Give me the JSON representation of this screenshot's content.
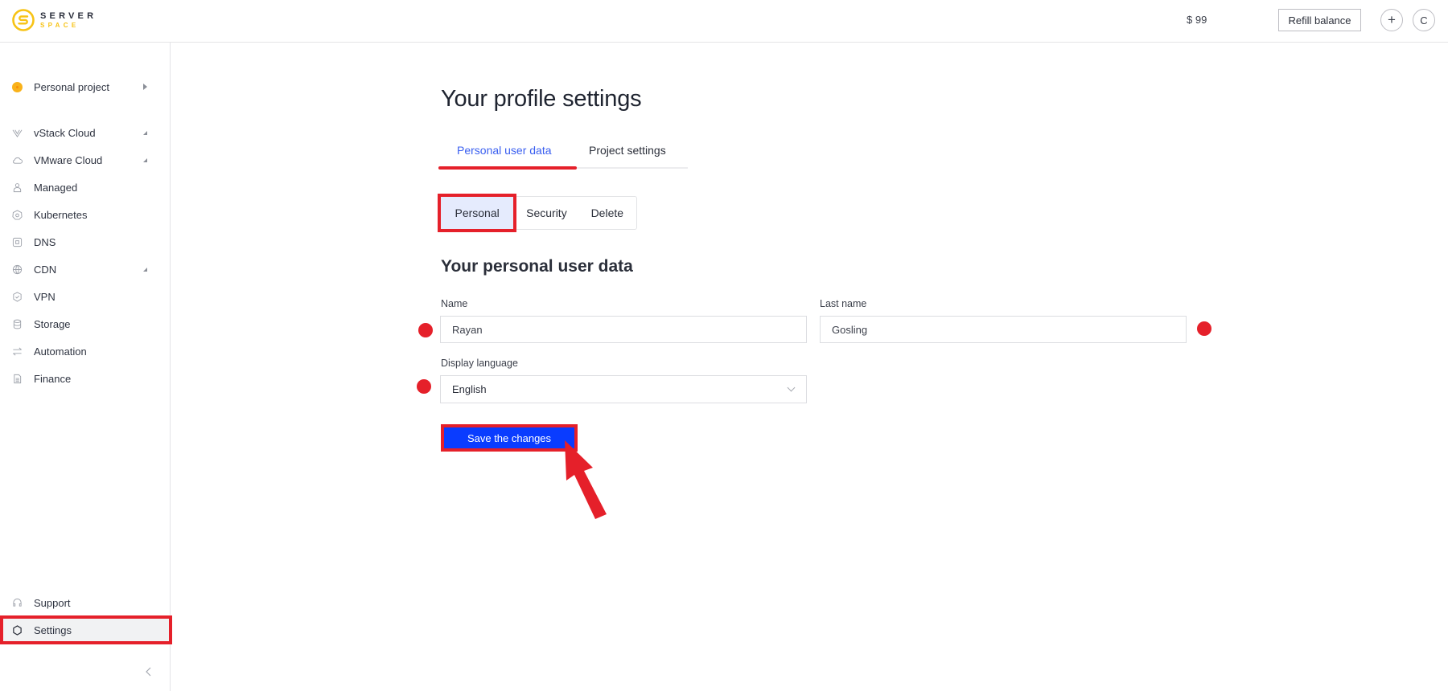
{
  "header": {
    "logo_line1": "SERVER",
    "logo_line2": "SPACE",
    "balance": "$ 99",
    "refill_label": "Refill balance",
    "add_label": "+",
    "avatar_initial": "C"
  },
  "sidebar": {
    "project": {
      "label": "Personal project",
      "icon": "project-dot-icon"
    },
    "items": [
      {
        "label": "vStack Cloud",
        "icon": "vstack-icon",
        "expandable": true
      },
      {
        "label": "VMware Cloud",
        "icon": "cloud-icon",
        "expandable": true
      },
      {
        "label": "Managed",
        "icon": "managed-icon",
        "expandable": false
      },
      {
        "label": "Kubernetes",
        "icon": "kubernetes-icon",
        "expandable": false
      },
      {
        "label": "DNS",
        "icon": "dns-icon",
        "expandable": false
      },
      {
        "label": "CDN",
        "icon": "globe-icon",
        "expandable": true
      },
      {
        "label": "VPN",
        "icon": "shield-check-icon",
        "expandable": false
      },
      {
        "label": "Storage",
        "icon": "database-icon",
        "expandable": false
      },
      {
        "label": "Automation",
        "icon": "arrows-icon",
        "expandable": false
      },
      {
        "label": "Finance",
        "icon": "document-icon",
        "expandable": false
      }
    ],
    "bottom": [
      {
        "label": "Support",
        "icon": "headset-icon"
      },
      {
        "label": "Settings",
        "icon": "gear-icon",
        "active": true
      }
    ],
    "collapse_icon": "chevron-left-icon"
  },
  "main": {
    "title": "Your profile settings",
    "tabs": [
      {
        "label": "Personal user data",
        "active": true
      },
      {
        "label": "Project settings",
        "active": false
      }
    ],
    "subtabs": [
      {
        "label": "Personal",
        "active": true
      },
      {
        "label": "Security",
        "active": false
      },
      {
        "label": "Delete",
        "active": false
      }
    ],
    "section_title": "Your personal user data",
    "form": {
      "name_label": "Name",
      "name_value": "Rayan",
      "last_name_label": "Last name",
      "last_name_value": "Gosling",
      "language_label": "Display language",
      "language_value": "English"
    },
    "save_label": "Save the changes"
  },
  "colors": {
    "accent_blue": "#0a3cff",
    "tab_active": "#3a5ff0",
    "annotation_red": "#e5202a",
    "logo_yellow": "#f7c316"
  }
}
